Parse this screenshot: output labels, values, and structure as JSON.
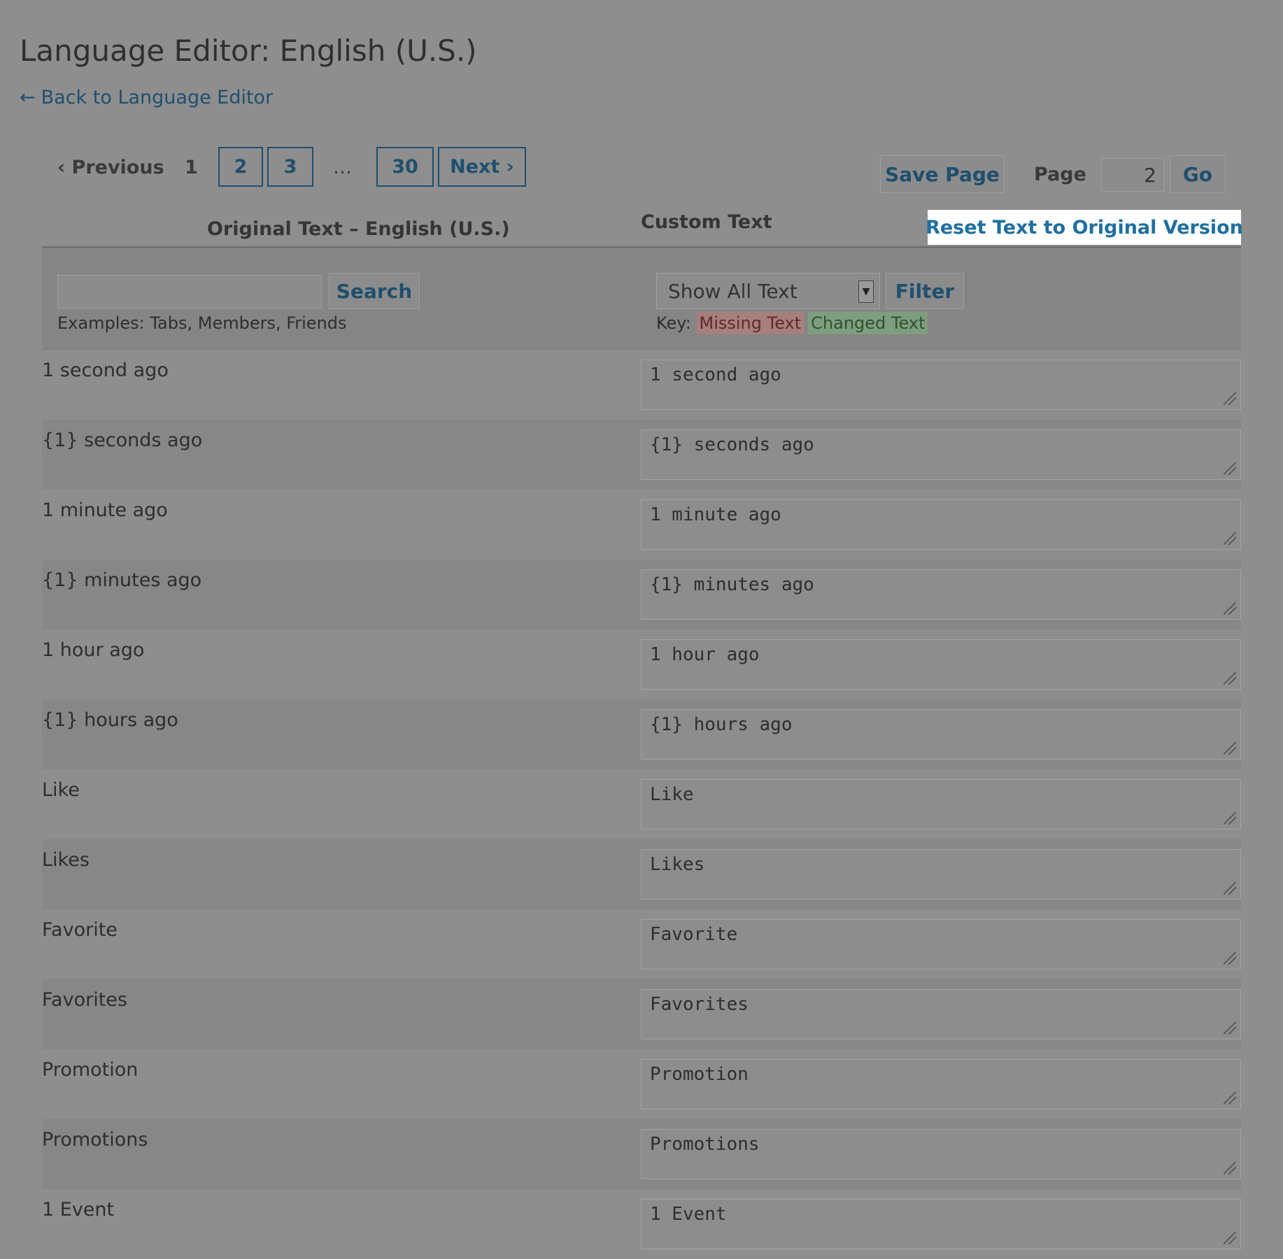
{
  "header": {
    "title": "Language Editor: English (U.S.)",
    "back_arrow": "←",
    "back_label": "Back to Language Editor"
  },
  "pagination": {
    "previous": "‹ Previous",
    "current": "1",
    "pages": [
      "2",
      "3"
    ],
    "ellipsis": "…",
    "last": "30",
    "next": "Next ›"
  },
  "toolbar": {
    "save_page": "Save Page",
    "page_label": "Page",
    "page_value": "2",
    "go": "Go"
  },
  "columns": {
    "original": "Original Text – English (U.S.)",
    "custom": "Custom Text",
    "reset": "Reset Text to Original Version"
  },
  "search": {
    "value": "",
    "button": "Search",
    "examples": "Examples: Tabs, Members, Friends"
  },
  "filter": {
    "selected": "Show All Text",
    "button": "Filter",
    "key_label": "Key:",
    "key_missing": "Missing Text",
    "key_changed": "Changed Text"
  },
  "rows": [
    {
      "original": "1 second ago",
      "custom": "1 second ago"
    },
    {
      "original": "{1} seconds ago",
      "custom": "{1} seconds ago"
    },
    {
      "original": "1 minute ago",
      "custom": "1 minute ago"
    },
    {
      "original": "{1} minutes ago",
      "custom": "{1} minutes ago"
    },
    {
      "original": "1 hour ago",
      "custom": "1 hour ago"
    },
    {
      "original": "{1} hours ago",
      "custom": "{1} hours ago"
    },
    {
      "original": "Like",
      "custom": "Like"
    },
    {
      "original": "Likes",
      "custom": "Likes"
    },
    {
      "original": "Favorite",
      "custom": "Favorite"
    },
    {
      "original": "Favorites",
      "custom": "Favorites"
    },
    {
      "original": "Promotion",
      "custom": "Promotion"
    },
    {
      "original": "Promotions",
      "custom": "Promotions"
    },
    {
      "original": "1 Event",
      "custom": "1 Event"
    }
  ]
}
